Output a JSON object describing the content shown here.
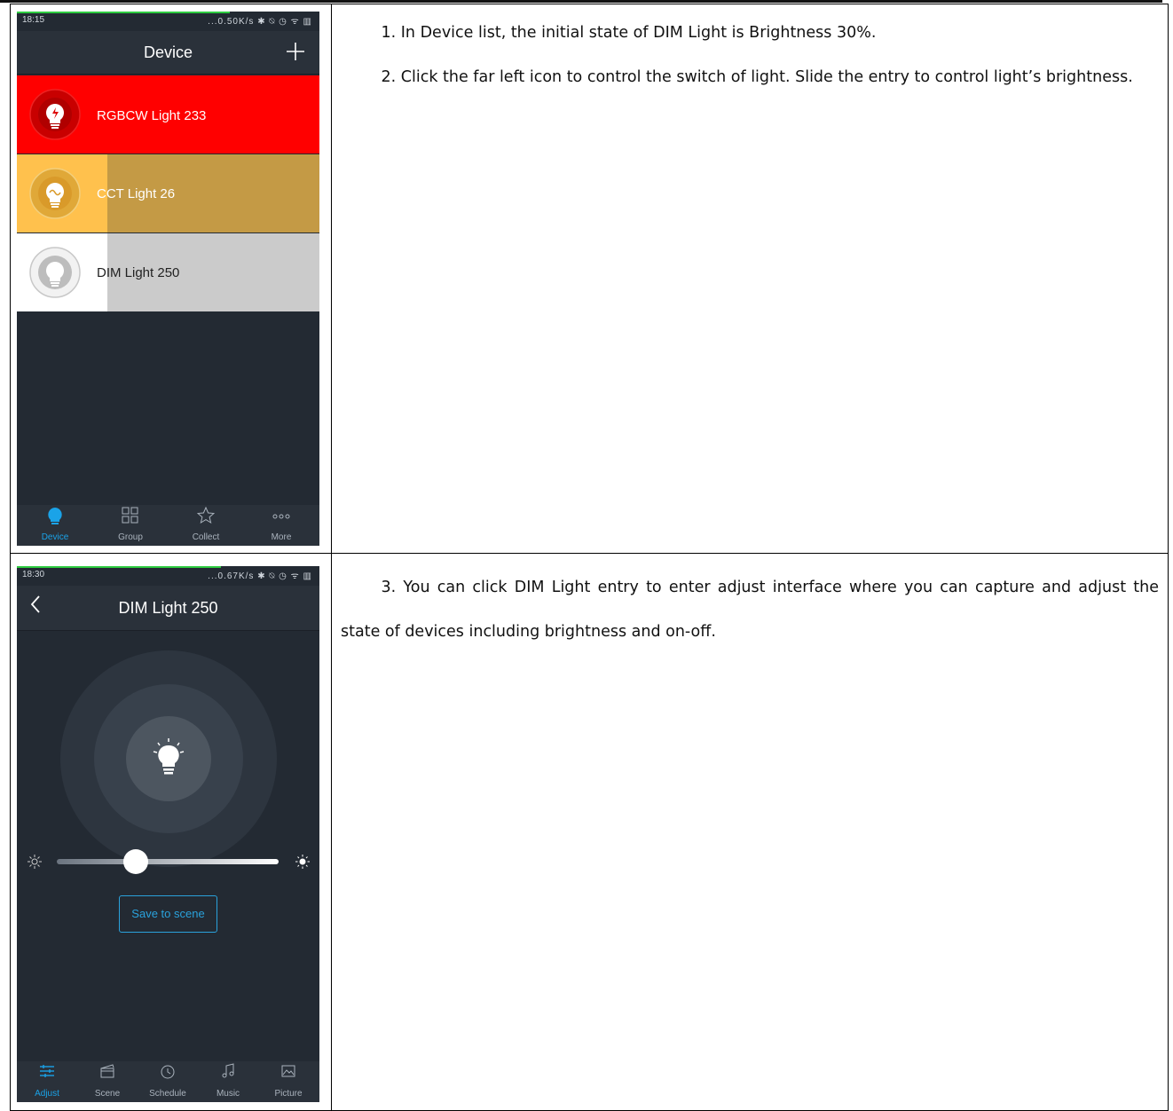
{
  "panel1": {
    "status": {
      "time": "18:15",
      "right": "...0.50K/s ✱ ⍉ ◷ ᯤ ▥"
    },
    "header": {
      "title": "Device",
      "add_icon": "plus-icon"
    },
    "devices": [
      {
        "label": "RGBCW Light 233",
        "color": "#ff0000",
        "icon": "rgbcw-bulb-icon"
      },
      {
        "label": "CCT Light 26",
        "color": "#ffc14d",
        "icon": "cct-bulb-icon"
      },
      {
        "label": "DIM Light 250",
        "color": "#ffffff",
        "icon": "dim-bulb-icon"
      }
    ],
    "tabs": [
      {
        "label": "Device",
        "icon": "bulb-icon",
        "active": true
      },
      {
        "label": "Group",
        "icon": "grid-icon",
        "active": false
      },
      {
        "label": "Collect",
        "icon": "star-icon",
        "active": false
      },
      {
        "label": "More",
        "icon": "more-dots-icon",
        "active": false
      }
    ]
  },
  "panel2": {
    "status": {
      "time": "18:30",
      "right": "...0.67K/s ✱ ⍉ ◷ ᯤ ▥"
    },
    "header": {
      "title": "DIM Light 250",
      "back_icon": "chevron-left-icon"
    },
    "brightness": 0.3,
    "save_button": "Save to scene",
    "tabs": [
      {
        "label": "Adjust",
        "icon": "sliders-icon",
        "active": true
      },
      {
        "label": "Scene",
        "icon": "clapper-icon",
        "active": false
      },
      {
        "label": "Schedule",
        "icon": "clock-icon",
        "active": false
      },
      {
        "label": "Music",
        "icon": "music-note-icon",
        "active": false
      },
      {
        "label": "Picture",
        "icon": "picture-icon",
        "active": false
      }
    ]
  },
  "instructions": {
    "step1": "1. In Device list, the initial state of DIM Light is Brightness 30%.",
    "step2": "2. Click the far left icon to control the switch of light. Slide the entry to control light’s brightness.",
    "step3": "3. You can click DIM Light entry to enter adjust interface where you can capture and adjust the state of devices including brightness and on-off."
  },
  "colors": {
    "accent": "#1aa3e8",
    "app_bg": "#232a33"
  }
}
